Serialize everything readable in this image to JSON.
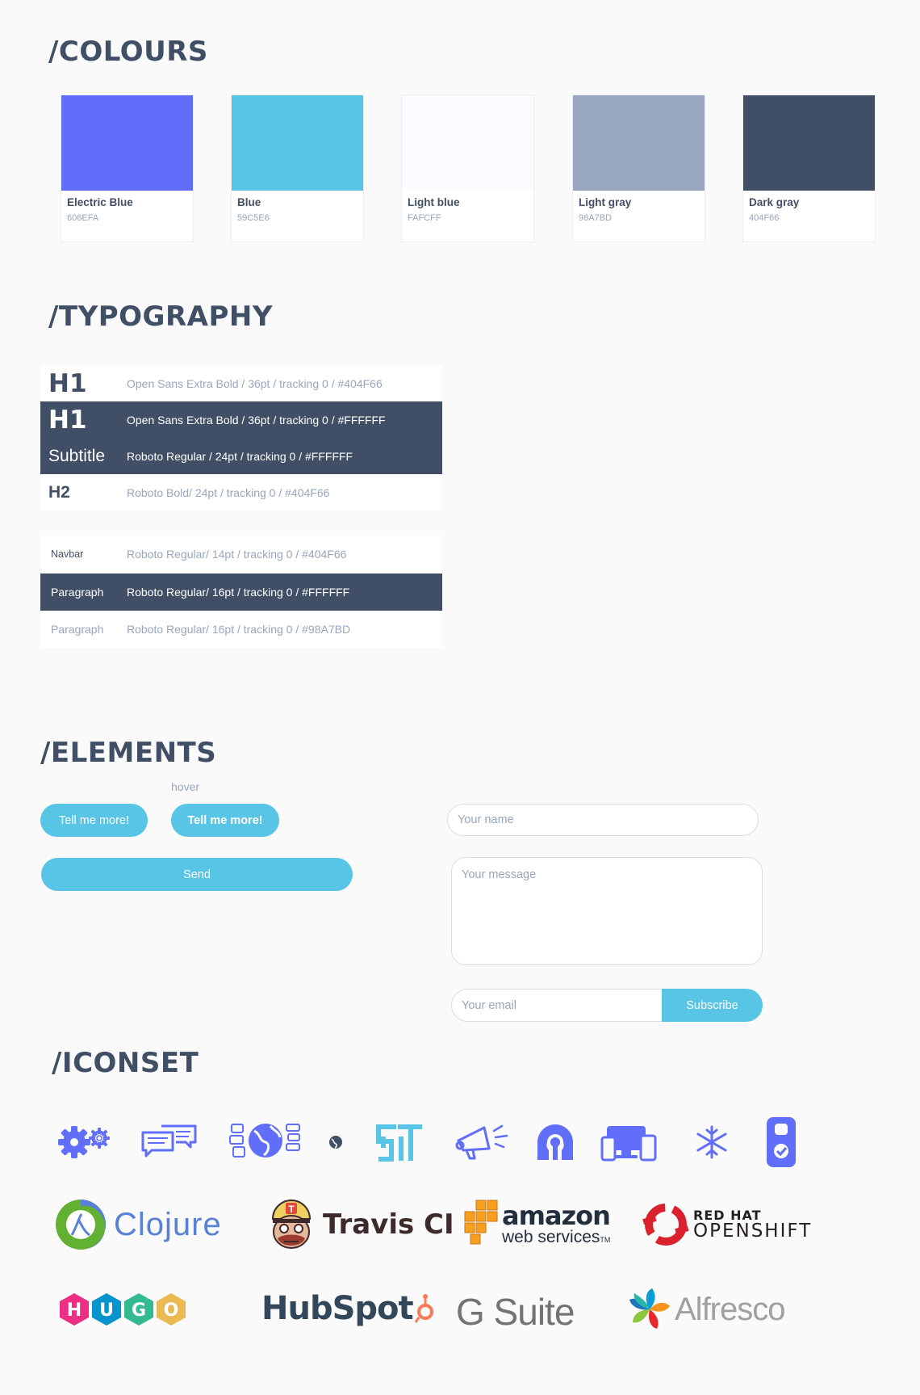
{
  "sections": {
    "colours": "/COLOURS",
    "typography": "/TYPOGRAPHY",
    "elements": "/ELEMENTS",
    "iconset": "/ICONSET"
  },
  "colours": [
    {
      "name": "Electric Blue",
      "hex": "606EFA",
      "color": "#606EFA"
    },
    {
      "name": "Blue",
      "hex": "59C5E6",
      "color": "#59C5E6"
    },
    {
      "name": "Light blue",
      "hex": "FAFCFF",
      "color": "#FAFCFF"
    },
    {
      "name": "Light gray",
      "hex": "98A7BD",
      "color": "#98A7BD"
    },
    {
      "name": "Dark gray",
      "hex": "404F66",
      "color": "#404F66"
    }
  ],
  "typography": {
    "headings": [
      {
        "label": "H1",
        "desc": "Open Sans Extra Bold / 36pt / tracking 0 / #404F66"
      },
      {
        "label": "H1",
        "desc": "Open Sans Extra Bold / 36pt / tracking 0 / #FFFFFF"
      },
      {
        "label": "Subtitle",
        "desc": "Roboto Regular / 24pt / tracking 0 / #FFFFFF"
      },
      {
        "label": "H2",
        "desc": "Roboto Bold/ 24pt / tracking 0 / #404F66"
      }
    ],
    "body": [
      {
        "label": "Navbar",
        "desc": "Roboto Regular/ 14pt / tracking 0 / #404F66"
      },
      {
        "label": "Paragraph",
        "desc": "Roboto Regular/ 16pt / tracking 0 / #FFFFFF"
      },
      {
        "label": "Paragraph",
        "desc": "Roboto Regular/ 16pt / tracking 0 / #98A7BD"
      }
    ]
  },
  "elements": {
    "hover_label": "hover",
    "button_label": "Tell me more!",
    "button_hover_label": "Tell me more!",
    "send_label": "Send",
    "name_placeholder": "Your name",
    "message_placeholder": "Your message",
    "email_placeholder": "Your email",
    "subscribe_label": "Subscribe"
  },
  "icons": [
    "gears-icon",
    "chat-bubbles-icon",
    "globe-grid-icon",
    "small-globe-icon",
    "st-logo-icon",
    "megaphone-icon",
    "keyhole-icon",
    "devices-icon",
    "snowflake-icon",
    "badge-check-icon"
  ],
  "logos": {
    "clojure": "Clojure",
    "travis": "Travis CI",
    "amazon_top": "amazon",
    "amazon_bottom": "web services",
    "amazon_tm": "TM",
    "redhat_top": "RED HAT",
    "redhat_bottom": "OPENSHIFT",
    "hugo_letters": [
      "H",
      "U",
      "G",
      "O"
    ],
    "hubspot": "HubSpot",
    "gsuite": "G Suite",
    "alfresco": "Alfresco"
  },
  "accent": "#59C5E6",
  "brand": "#606EFA"
}
